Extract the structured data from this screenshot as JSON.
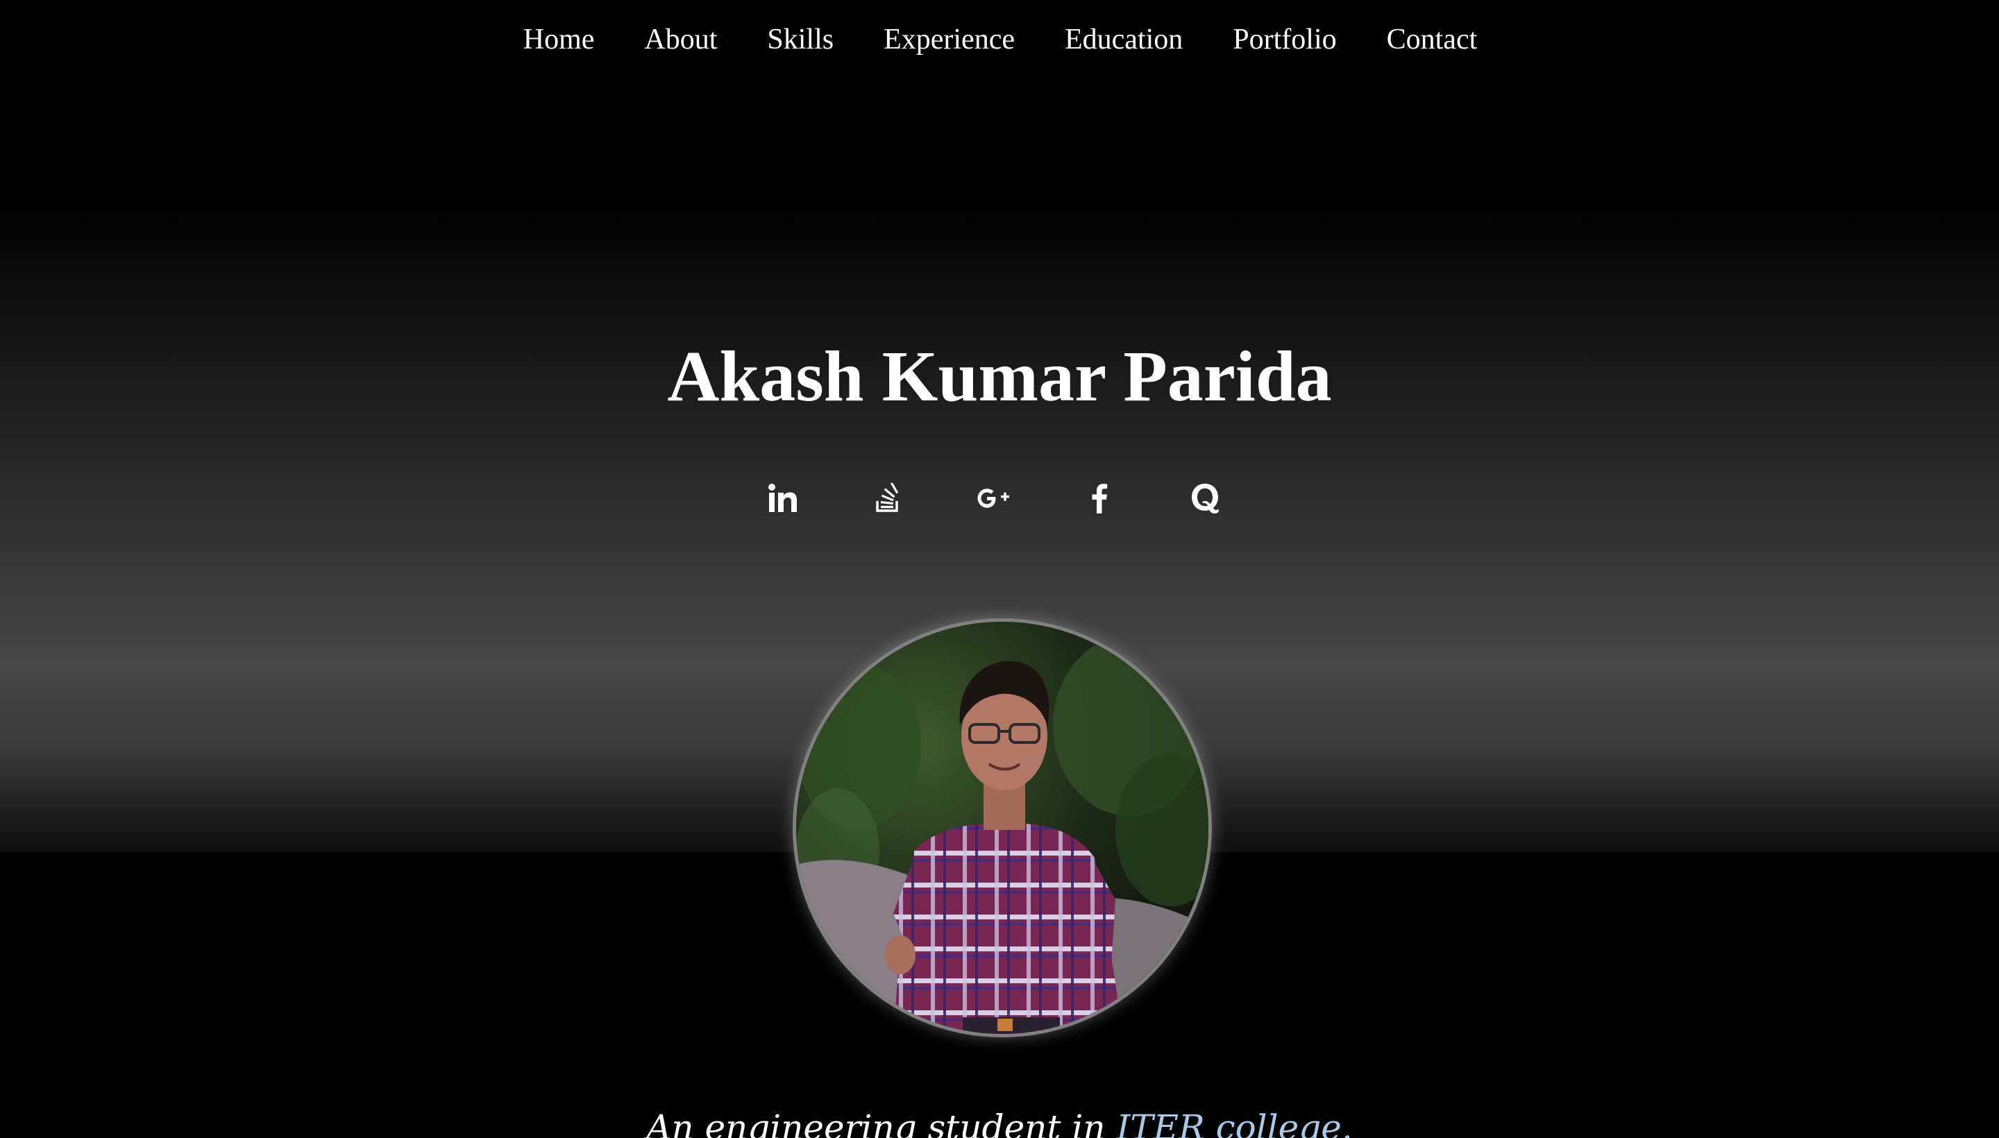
{
  "nav": {
    "items": [
      {
        "label": "Home"
      },
      {
        "label": "About"
      },
      {
        "label": "Skills"
      },
      {
        "label": "Experience"
      },
      {
        "label": "Education"
      },
      {
        "label": "Portfolio"
      },
      {
        "label": "Contact"
      }
    ]
  },
  "hero": {
    "name": "Akash Kumar Parida",
    "socials": [
      {
        "icon": "linkedin-icon"
      },
      {
        "icon": "stackoverflow-icon"
      },
      {
        "icon": "google-plus-icon"
      },
      {
        "icon": "facebook-icon"
      },
      {
        "icon": "quora-icon"
      }
    ],
    "tagline_prefix": "An engineering student in ",
    "tagline_link": "ITER college.",
    "link_color": "#a9c9e8"
  }
}
